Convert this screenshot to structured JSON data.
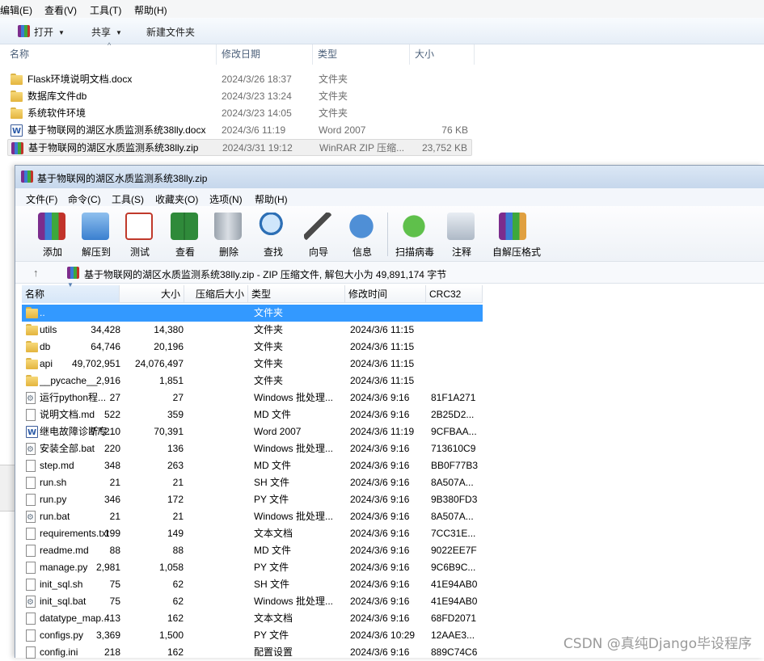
{
  "explorer": {
    "menu": [
      "编辑(E)",
      "查看(V)",
      "工具(T)",
      "帮助(H)"
    ],
    "toolbar": {
      "open": "打开",
      "share": "共享",
      "new_folder": "新建文件夹"
    },
    "columns": {
      "name": "名称",
      "date": "修改日期",
      "type": "类型",
      "size": "大小"
    },
    "files": [
      {
        "name": "Flask环境说明文档.docx",
        "date": "2024/3/26 18:37",
        "type": "文件夹",
        "size": "",
        "icon": "folder-icon"
      },
      {
        "name": "数据库文件db",
        "date": "2024/3/23 13:24",
        "type": "文件夹",
        "size": "",
        "icon": "folder-icon"
      },
      {
        "name": "系统软件环境",
        "date": "2024/3/23 14:05",
        "type": "文件夹",
        "size": "",
        "icon": "folder-icon"
      },
      {
        "name": "基于物联网的湖区水质监测系统38lly.docx",
        "date": "2024/3/6 11:19",
        "type": "Word 2007",
        "size": "76 KB",
        "icon": "word-document-icon"
      },
      {
        "name": "基于物联网的湖区水质监测系统38lly.zip",
        "date": "2024/3/31 19:12",
        "type": "WinRAR ZIP 压缩...",
        "size": "23,752 KB",
        "icon": "winrar-archive-icon"
      }
    ]
  },
  "winrar": {
    "title": "基于物联网的湖区水质监测系统38lly.zip",
    "menu": [
      "文件(F)",
      "命令(C)",
      "工具(S)",
      "收藏夹(O)",
      "选项(N)",
      "帮助(H)"
    ],
    "tools": [
      "添加",
      "解压到",
      "测试",
      "查看",
      "删除",
      "查找",
      "向导",
      "信息",
      "扫描病毒",
      "注释",
      "自解压格式"
    ],
    "path_text": "基于物联网的湖区水质监测系统38lly.zip - ZIP 压缩文件, 解包大小为 49,891,174 字节",
    "columns": {
      "name": "名称",
      "size": "大小",
      "packed": "压缩后大小",
      "type": "类型",
      "modified": "修改时间",
      "crc": "CRC32"
    },
    "rows": [
      {
        "name": "..",
        "size": "",
        "packed": "",
        "type": "文件夹",
        "modified": "",
        "crc": "",
        "icon": "parent-folder-icon"
      },
      {
        "name": "utils",
        "size": "34,428",
        "packed": "14,380",
        "type": "文件夹",
        "modified": "2024/3/6 11:15",
        "crc": "",
        "icon": "folder-icon"
      },
      {
        "name": "db",
        "size": "64,746",
        "packed": "20,196",
        "type": "文件夹",
        "modified": "2024/3/6 11:15",
        "crc": "",
        "icon": "folder-icon"
      },
      {
        "name": "api",
        "size": "49,702,951",
        "packed": "24,076,497",
        "type": "文件夹",
        "modified": "2024/3/6 11:15",
        "crc": "",
        "icon": "folder-icon"
      },
      {
        "name": "__pycache__",
        "size": "2,916",
        "packed": "1,851",
        "type": "文件夹",
        "modified": "2024/3/6 11:15",
        "crc": "",
        "icon": "folder-icon"
      },
      {
        "name": "运行python程...",
        "size": "27",
        "packed": "27",
        "type": "Windows 批处理...",
        "modified": "2024/3/6 9:16",
        "crc": "81F1A271",
        "icon": "batch-file-icon"
      },
      {
        "name": "说明文档.md",
        "size": "522",
        "packed": "359",
        "type": "MD 文件",
        "modified": "2024/3/6 9:16",
        "crc": "2B25D2...",
        "icon": "file-icon"
      },
      {
        "name": "继电故障诊断专...",
        "size": "77,210",
        "packed": "70,391",
        "type": "Word 2007",
        "modified": "2024/3/6 11:19",
        "crc": "9CFBAA...",
        "icon": "word-document-icon"
      },
      {
        "name": "安装全部.bat",
        "size": "220",
        "packed": "136",
        "type": "Windows 批处理...",
        "modified": "2024/3/6 9:16",
        "crc": "713610C9",
        "icon": "batch-file-icon"
      },
      {
        "name": "step.md",
        "size": "348",
        "packed": "263",
        "type": "MD 文件",
        "modified": "2024/3/6 9:16",
        "crc": "BB0F77B3",
        "icon": "file-icon"
      },
      {
        "name": "run.sh",
        "size": "21",
        "packed": "21",
        "type": "SH 文件",
        "modified": "2024/3/6 9:16",
        "crc": "8A507A...",
        "icon": "file-icon"
      },
      {
        "name": "run.py",
        "size": "346",
        "packed": "172",
        "type": "PY 文件",
        "modified": "2024/3/6 9:16",
        "crc": "9B380FD3",
        "icon": "file-icon"
      },
      {
        "name": "run.bat",
        "size": "21",
        "packed": "21",
        "type": "Windows 批处理...",
        "modified": "2024/3/6 9:16",
        "crc": "8A507A...",
        "icon": "batch-file-icon"
      },
      {
        "name": "requirements.txt",
        "size": "199",
        "packed": "149",
        "type": "文本文档",
        "modified": "2024/3/6 9:16",
        "crc": "7CC31E...",
        "icon": "file-icon"
      },
      {
        "name": "readme.md",
        "size": "88",
        "packed": "88",
        "type": "MD 文件",
        "modified": "2024/3/6 9:16",
        "crc": "9022EE7F",
        "icon": "file-icon"
      },
      {
        "name": "manage.py",
        "size": "2,981",
        "packed": "1,058",
        "type": "PY 文件",
        "modified": "2024/3/6 9:16",
        "crc": "9C6B9C...",
        "icon": "file-icon"
      },
      {
        "name": "init_sql.sh",
        "size": "75",
        "packed": "62",
        "type": "SH 文件",
        "modified": "2024/3/6 9:16",
        "crc": "41E94AB0",
        "icon": "file-icon"
      },
      {
        "name": "init_sql.bat",
        "size": "75",
        "packed": "62",
        "type": "Windows 批处理...",
        "modified": "2024/3/6 9:16",
        "crc": "41E94AB0",
        "icon": "batch-file-icon"
      },
      {
        "name": "datatype_map....",
        "size": "413",
        "packed": "162",
        "type": "文本文档",
        "modified": "2024/3/6 9:16",
        "crc": "68FD2071",
        "icon": "file-icon"
      },
      {
        "name": "configs.py",
        "size": "3,369",
        "packed": "1,500",
        "type": "PY 文件",
        "modified": "2024/3/6 10:29",
        "crc": "12AAE3...",
        "icon": "file-icon"
      },
      {
        "name": "config.ini",
        "size": "218",
        "packed": "162",
        "type": "配置设置",
        "modified": "2024/3/6 9:16",
        "crc": "889C74C6",
        "icon": "file-icon"
      }
    ]
  },
  "watermark": "CSDN @真纯Django毕设程序",
  "colors": {
    "selection": "#3399ff",
    "explorer_toolbar": "#e6eef7",
    "titlebar": "#c6d7ec"
  }
}
